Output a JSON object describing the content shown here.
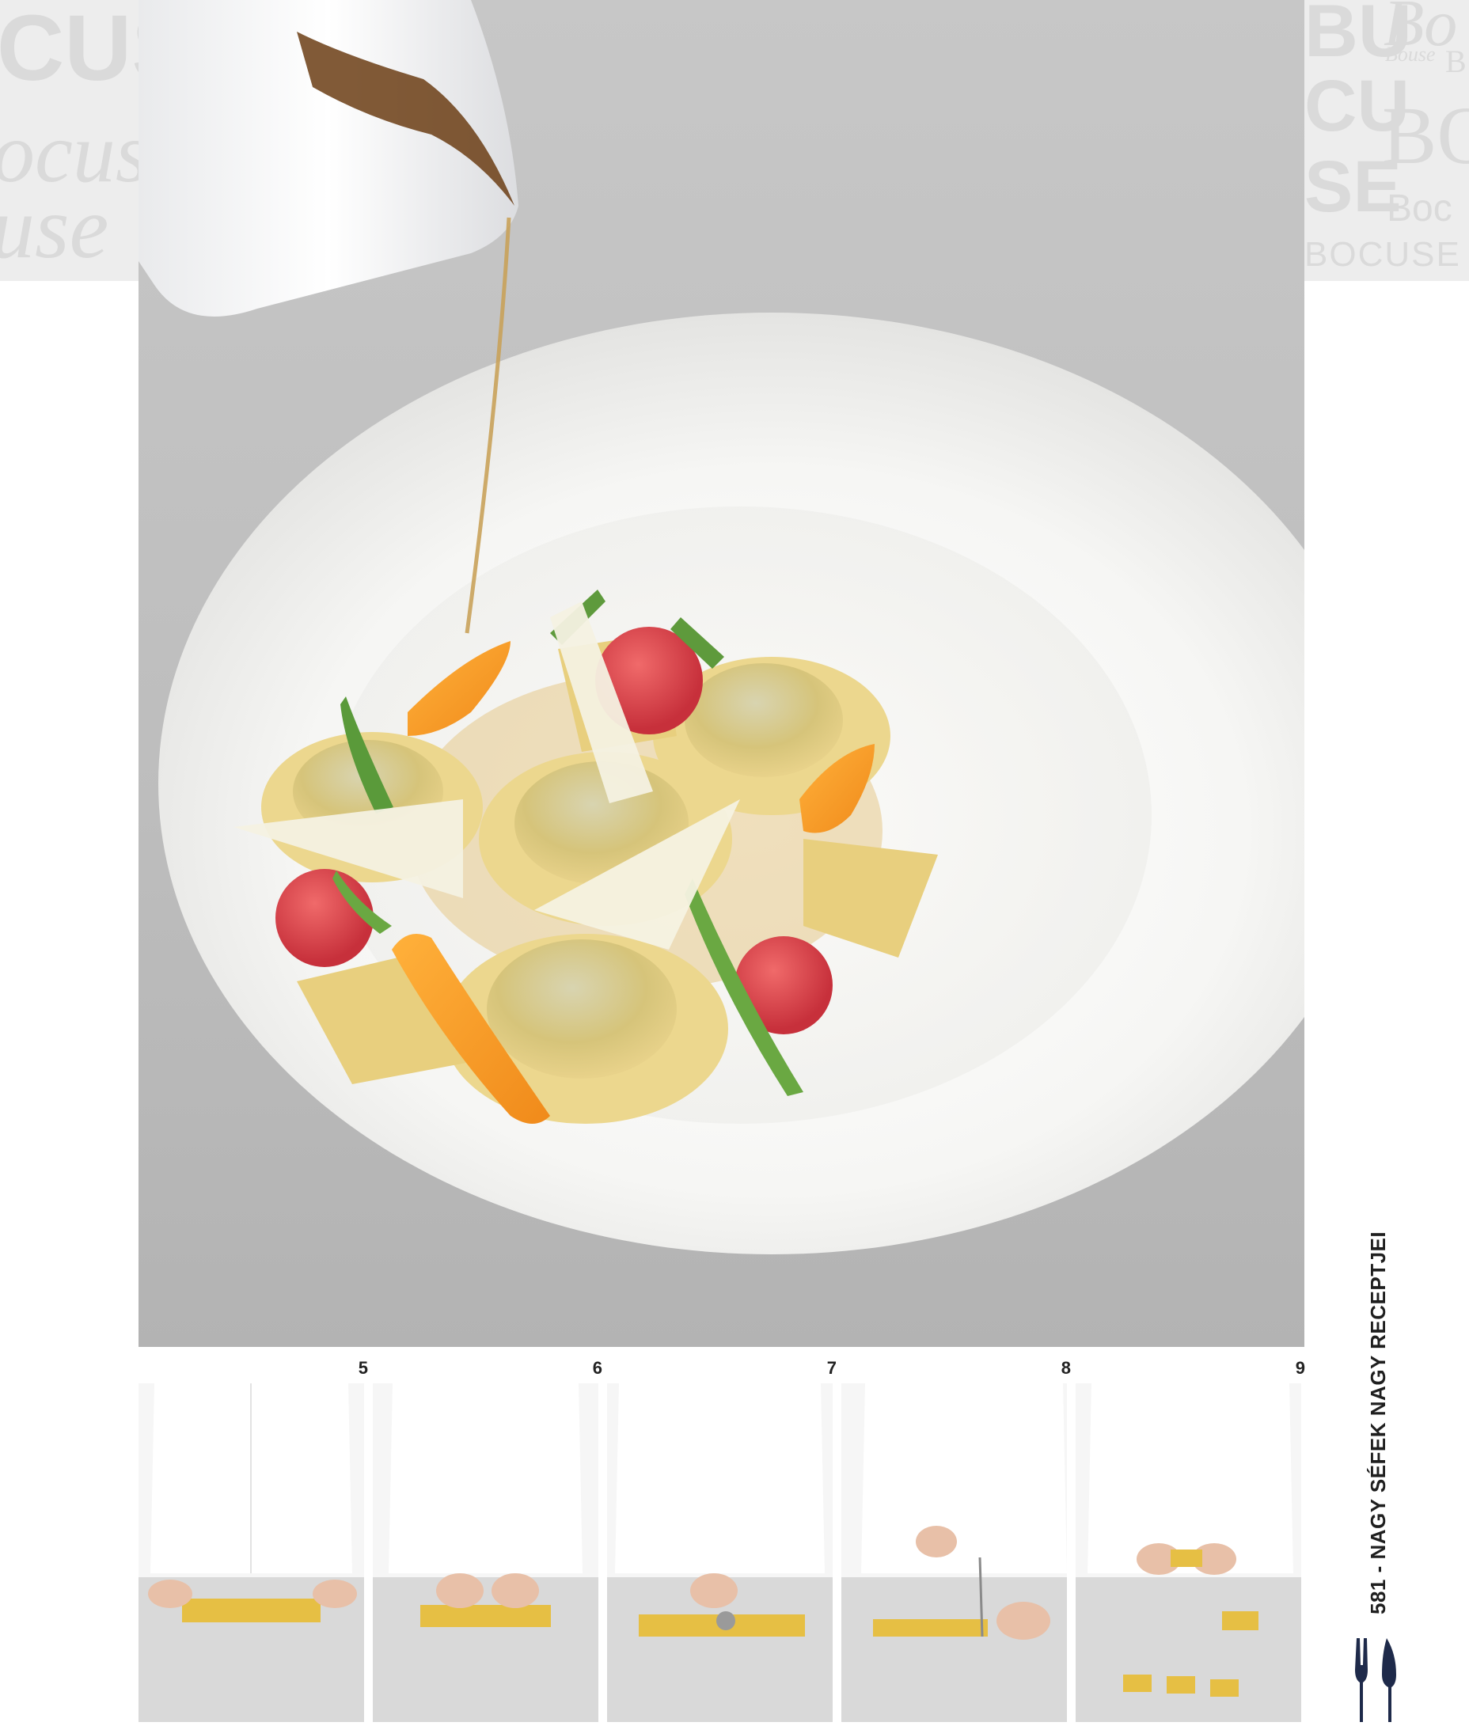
{
  "decor": {
    "left_lines": [
      "CUSE",
      "ocuse",
      "use"
    ],
    "right_lines": [
      "BU",
      "Bo",
      "Bouse",
      "B",
      "CU",
      "BO",
      "SE",
      "Boc",
      "BOCUSE"
    ]
  },
  "steps": [
    {
      "number": "5"
    },
    {
      "number": "6"
    },
    {
      "number": "7"
    },
    {
      "number": "8"
    },
    {
      "number": "9"
    }
  ],
  "sidebar": {
    "title": "581 - NAGY SÉFEK NAGY RECEPTJEI"
  },
  "colors": {
    "background": "#ffffff",
    "decor_gray": "#ededed",
    "text": "#1f1f1f",
    "icon_navy": "#1e2a4a"
  },
  "icons": {
    "fork_icon": "fork-icon"
  }
}
